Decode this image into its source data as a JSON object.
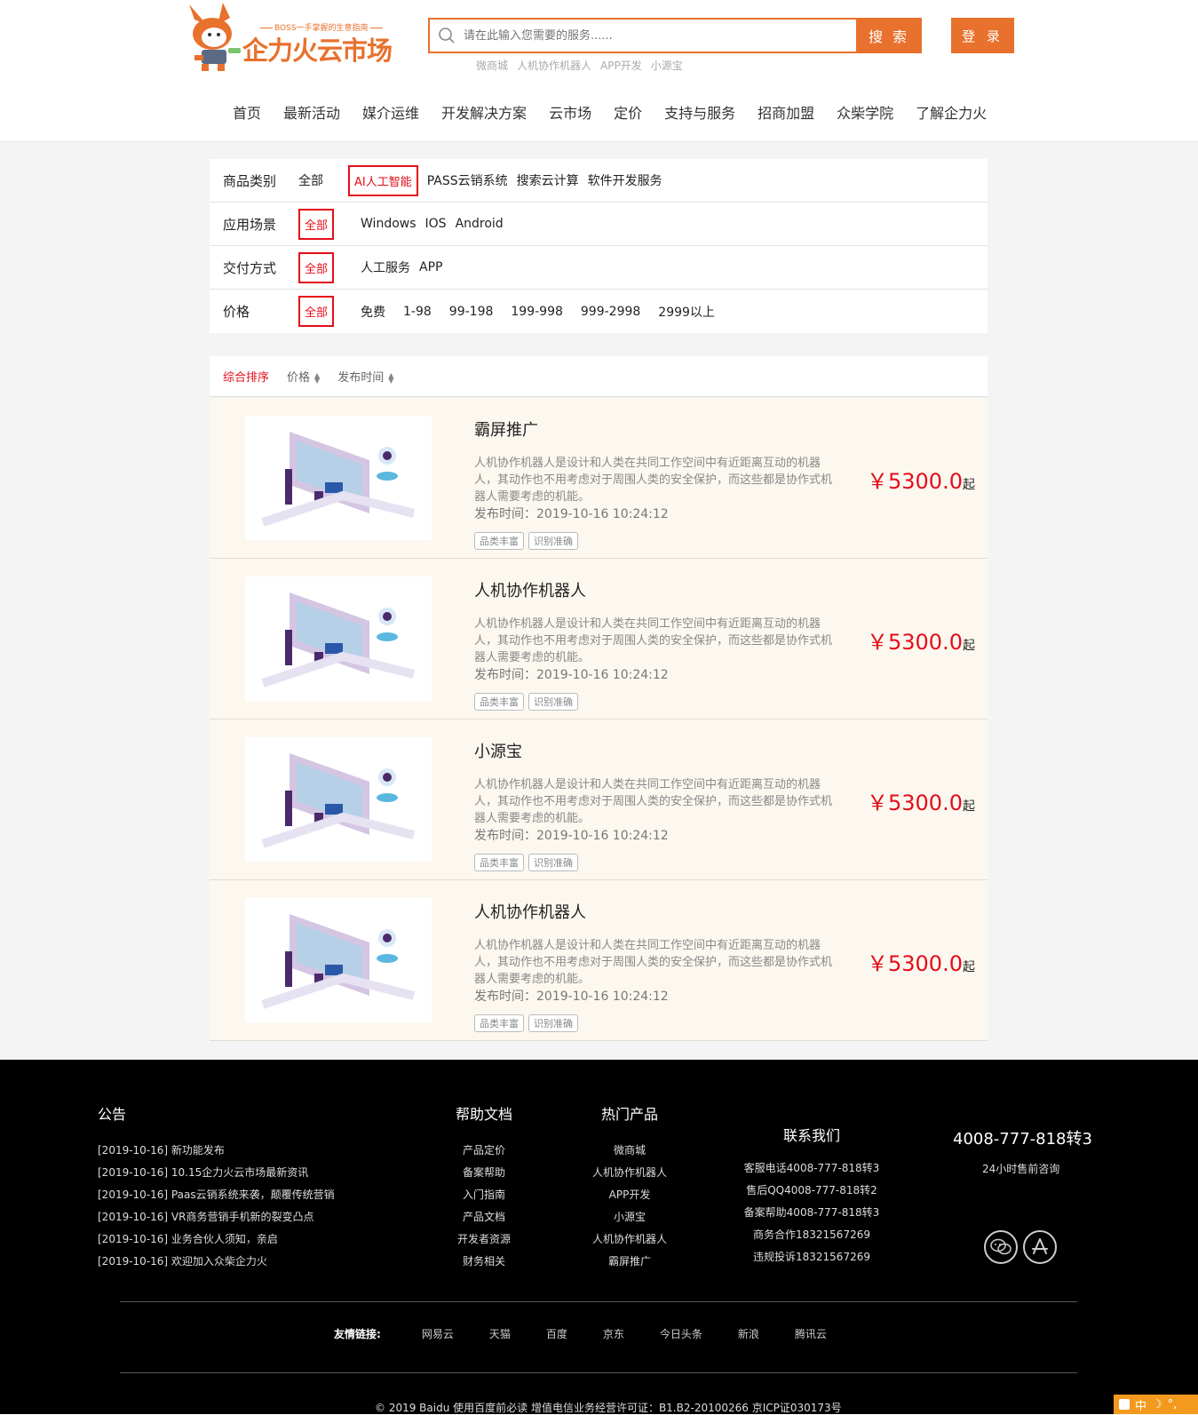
{
  "header": {
    "slogan": "BOSS一手掌握的生意指南",
    "brand": "企力火云市场",
    "search_placeholder": "请在此输入您需要的服务......",
    "search_button": "搜 索",
    "hot_words": [
      "微商城",
      "人机协作机器人",
      "APP开发",
      "小源宝"
    ],
    "login_button": "登 录"
  },
  "nav": [
    "首页",
    "最新活动",
    "媒介运维",
    "开发解决方案",
    "云市场",
    "定价",
    "支持与服务",
    "招商加盟",
    "众柴学院",
    "了解企力火"
  ],
  "filters": [
    {
      "label": "商品类别",
      "options": [
        "全部",
        "AI人工智能",
        "PASS云销系统",
        "搜索云计算",
        "软件开发服务"
      ],
      "selected": 1
    },
    {
      "label": "应用场景",
      "options": [
        "全部",
        "Windows",
        "IOS",
        "Android"
      ],
      "selected": 0
    },
    {
      "label": "交付方式",
      "options": [
        "全部",
        "人工服务",
        "APP"
      ],
      "selected": 0
    },
    {
      "label": "价格",
      "options": [
        "全部",
        "免费",
        "1-98",
        "99-198",
        "199-998",
        "999-2998",
        "2999以上"
      ],
      "selected": 0
    }
  ],
  "sort": {
    "default": "综合排序",
    "price": "价格",
    "time": "发布时间"
  },
  "products": [
    {
      "title": "霸屏推广",
      "desc": "人机协作机器人是设计和人类在共同工作空间中有近距离互动的机器人，其动作也不用考虑对于周围人类的安全保护，而这些都是协作式机器人需要考虑的机能。",
      "time": "发布时间：2019-10-16 10:24:12",
      "tags": [
        "品类丰富",
        "识别准确"
      ],
      "price": "￥5300.0",
      "price_suffix": "起"
    },
    {
      "title": "人机协作机器人",
      "desc": "人机协作机器人是设计和人类在共同工作空间中有近距离互动的机器人，其动作也不用考虑对于周围人类的安全保护，而这些都是协作式机器人需要考虑的机能。",
      "time": "发布时间：2019-10-16 10:24:12",
      "tags": [
        "品类丰富",
        "识别准确"
      ],
      "price": "￥5300.0",
      "price_suffix": "起"
    },
    {
      "title": "小源宝",
      "desc": "人机协作机器人是设计和人类在共同工作空间中有近距离互动的机器人，其动作也不用考虑对于周围人类的安全保护，而这些都是协作式机器人需要考虑的机能。",
      "time": "发布时间：2019-10-16 10:24:12",
      "tags": [
        "品类丰富",
        "识别准确"
      ],
      "price": "￥5300.0",
      "price_suffix": "起"
    },
    {
      "title": "人机协作机器人",
      "desc": "人机协作机器人是设计和人类在共同工作空间中有近距离互动的机器人，其动作也不用考虑对于周围人类的安全保护，而这些都是协作式机器人需要考虑的机能。",
      "time": "发布时间：2019-10-16 10:24:12",
      "tags": [
        "品类丰富",
        "识别准确"
      ],
      "price": "￥5300.0",
      "price_suffix": "起"
    }
  ],
  "footer": {
    "notice_title": "公告",
    "notices": [
      "[2019-10-16] 新功能发布",
      "[2019-10-16] 10.15企力火云市场最新资讯",
      "[2019-10-16] Paas云销系统来袭，颠覆传统营销",
      "[2019-10-16] VR商务营销手机新的裂变凸点",
      "[2019-10-16] 业务合伙人须知，亲启",
      "[2019-10-16] 欢迎加入众柴企力火"
    ],
    "help_title": "帮助文档",
    "help": [
      "产品定价",
      "备案帮助",
      "入门指南",
      "产品文档",
      "开发者资源",
      "财务相关"
    ],
    "hot_title": "热门产品",
    "hot": [
      "微商城",
      "人机协作机器人",
      "APP开发",
      "小源宝",
      "人机协作机器人",
      "霸屏推广"
    ],
    "contact_title": "联系我们",
    "contact": [
      "客服电话4008-777-818转3",
      "售后QQ4008-777-818转2",
      "备案帮助4008-777-818转3",
      "商务合作18321567269",
      "违规投诉18321567269"
    ],
    "phone": "4008-777-818转3",
    "phone_sub": "24小时售前咨询",
    "links_label": "友情链接:",
    "links": [
      "网易云",
      "天猫",
      "百度",
      "京东",
      "今日头条",
      "新浪",
      "腾讯云"
    ],
    "copyright": "© 2019 Baidu 使用百度前必读 增值电信业务经营许可证：B1.B2-20100266 京ICP证030173号"
  },
  "ime": {
    "label": "中"
  },
  "colors": {
    "accent": "#e8712d",
    "selected": "#e40d19",
    "footer_bg": "#000000",
    "item_bg": "#fcf8f0"
  }
}
